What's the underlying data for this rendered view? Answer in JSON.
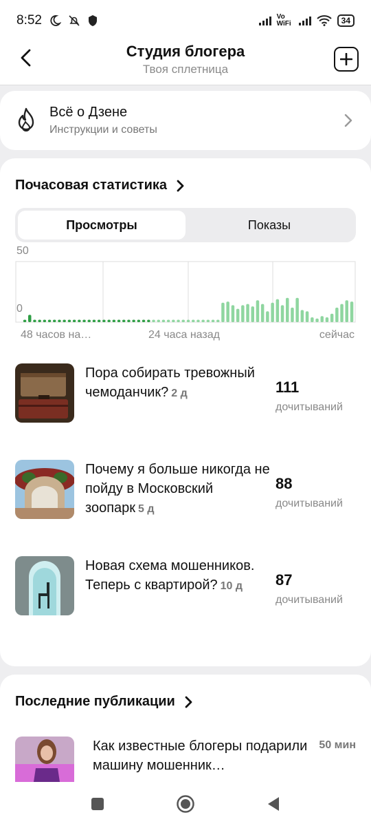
{
  "status_bar": {
    "time": "8:52",
    "network": "Vo WiFi",
    "battery": "34"
  },
  "header": {
    "title": "Студия блогера",
    "subtitle": "Твоя сплетница"
  },
  "dzen_card": {
    "title": "Всё о Дзене",
    "subtitle": "Инструкции и советы"
  },
  "stats": {
    "title": "Почасовая статистика",
    "tabs": [
      {
        "label": "Просмотры",
        "active": true
      },
      {
        "label": "Показы",
        "active": false
      }
    ],
    "x_labels": [
      "48 часов на…",
      "24 часа назад",
      "сейчас"
    ]
  },
  "chart_data": {
    "type": "bar",
    "ylim": [
      0,
      50
    ],
    "y_ticks": [
      "50",
      "0"
    ],
    "x_tick_labels": [
      "48 часов на…",
      "24 часа назад",
      "сейчас"
    ],
    "grid": true,
    "colors": {
      "past": "#2e9e44",
      "recent": "#8fd6a0"
    },
    "values": [
      2,
      6,
      2,
      2,
      2,
      2,
      2,
      2,
      2,
      2,
      2,
      2,
      2,
      2,
      2,
      2,
      2,
      2,
      2,
      2,
      2,
      2,
      2,
      2,
      2,
      2,
      2,
      2,
      2,
      2,
      2,
      2,
      2,
      2,
      2,
      2,
      2,
      2,
      2,
      2,
      16,
      17,
      14,
      11,
      14,
      15,
      13,
      18,
      15,
      9,
      16,
      19,
      14,
      20,
      12,
      20,
      10,
      9,
      4,
      3,
      5,
      4,
      7,
      12,
      15,
      18,
      17
    ],
    "recent_from_index": 26
  },
  "articles": [
    {
      "title": "Пора собирать тревожный чемоданчик?",
      "age": "2 д",
      "count": "111",
      "count_label": "дочитываний",
      "thumb": "suitcase"
    },
    {
      "title": "Почему я больше никогда не пойду в Московский зоопарк",
      "age": "5 д",
      "count": "88",
      "count_label": "дочитываний",
      "thumb": "zoo"
    },
    {
      "title": "Новая схема мошенников. Теперь с квартирой?",
      "age": "10 д",
      "count": "87",
      "count_label": "дочитываний",
      "thumb": "chair"
    }
  ],
  "publications": {
    "title": "Последние публикации",
    "items": [
      {
        "title": "Как известные блогеры подарили машину мошенник…",
        "time": "50 мин"
      }
    ]
  },
  "icons": {
    "back": "back-arrow-icon",
    "add": "plus-square-icon",
    "dzen": "flame-icon",
    "chevron": "chevron-right-icon"
  }
}
